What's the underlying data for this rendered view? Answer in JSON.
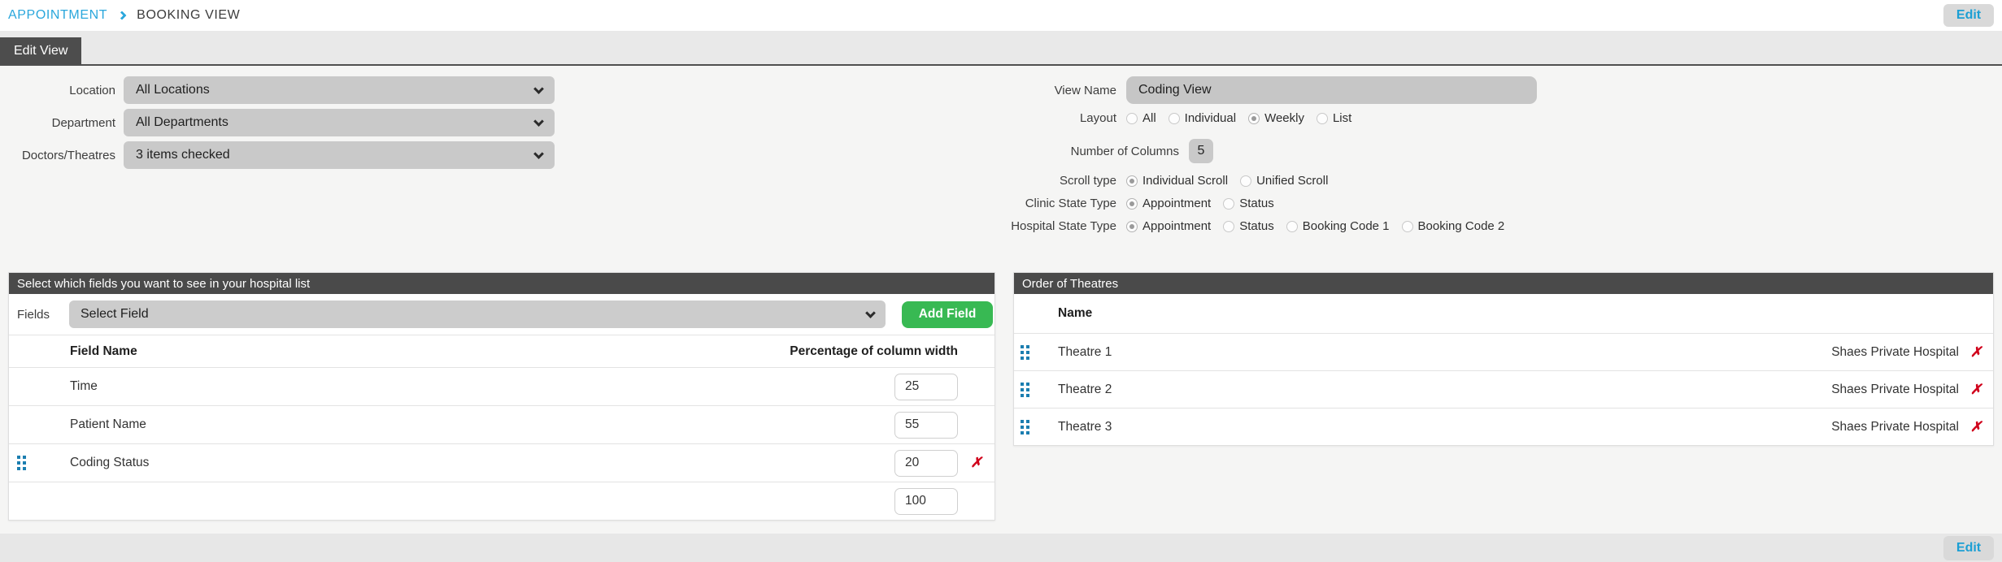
{
  "colors": {
    "accent_blue": "#2aa7dc",
    "green": "#38b953",
    "red": "#d0021b",
    "header_dark": "#4a4a4a",
    "handle_blue": "#1b7eb0"
  },
  "breadcrumb": {
    "section": "APPOINTMENT",
    "page": "BOOKING VIEW"
  },
  "header": {
    "edit_button": "Edit"
  },
  "tabs": {
    "edit_view": "Edit View"
  },
  "filters": {
    "location": {
      "label": "Location",
      "value": "All Locations"
    },
    "department": {
      "label": "Department",
      "value": "All Departments"
    },
    "doctors_theatres": {
      "label": "Doctors/Theatres",
      "value": "3 items checked"
    }
  },
  "view_form": {
    "view_name": {
      "label": "View Name",
      "value": "Coding View"
    },
    "layout": {
      "label": "Layout",
      "options": [
        {
          "label": "All",
          "selected": false
        },
        {
          "label": "Individual",
          "selected": false
        },
        {
          "label": "Weekly",
          "selected": true
        },
        {
          "label": "List",
          "selected": false
        }
      ]
    },
    "number_of_columns": {
      "label": "Number of Columns",
      "value": "5"
    },
    "scroll_type": {
      "label": "Scroll type",
      "options": [
        {
          "label": "Individual Scroll",
          "selected": true
        },
        {
          "label": "Unified Scroll",
          "selected": false
        }
      ]
    },
    "clinic_state_type": {
      "label": "Clinic State Type",
      "options": [
        {
          "label": "Appointment",
          "selected": true
        },
        {
          "label": "Status",
          "selected": false
        }
      ]
    },
    "hospital_state_type": {
      "label": "Hospital State Type",
      "options": [
        {
          "label": "Appointment",
          "selected": true
        },
        {
          "label": "Status",
          "selected": false
        },
        {
          "label": "Booking Code 1",
          "selected": false
        },
        {
          "label": "Booking Code 2",
          "selected": false
        }
      ]
    }
  },
  "fields_panel": {
    "title": "Select which fields you want to see in your hospital list",
    "fields_label": "Fields",
    "select_value": "Select Field",
    "add_button": "Add Field",
    "columns": {
      "name": "Field Name",
      "width": "Percentage of column width"
    },
    "rows": [
      {
        "name": "Time",
        "width": "25"
      },
      {
        "name": "Patient Name",
        "width": "55"
      },
      {
        "name": "Coding Status",
        "width": "20"
      }
    ],
    "total_width": "100"
  },
  "theatres_panel": {
    "title": "Order of Theatres",
    "name_column": "Name",
    "rows": [
      {
        "name": "Theatre 1",
        "hospital": "Shaes Private Hospital"
      },
      {
        "name": "Theatre 2",
        "hospital": "Shaes Private Hospital"
      },
      {
        "name": "Theatre 3",
        "hospital": "Shaes Private Hospital"
      }
    ]
  },
  "footer": {
    "edit_button": "Edit"
  }
}
